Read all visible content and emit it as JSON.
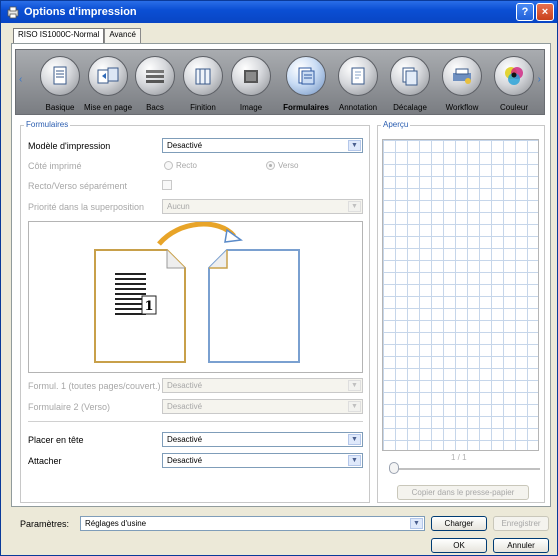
{
  "window": {
    "title": "Options d'impression",
    "help_glyph": "?",
    "close_glyph": "×"
  },
  "tabs": [
    {
      "label": "RISO IS1000C-Normal"
    },
    {
      "label": "Avancé"
    }
  ],
  "iconbar": {
    "left_arrow": "‹",
    "right_arrow": "›",
    "items": [
      {
        "label": "Basique",
        "icon": "document-icon"
      },
      {
        "label": "Mise en page",
        "icon": "layout-icon"
      },
      {
        "label": "Bacs",
        "icon": "paper-trays-icon"
      },
      {
        "label": "Finition",
        "icon": "finishing-icon"
      },
      {
        "label": "Image",
        "icon": "image-icon"
      },
      {
        "label": "Formulaires",
        "icon": "forms-icon"
      },
      {
        "label": "Annotation",
        "icon": "annotation-icon"
      },
      {
        "label": "Décalage",
        "icon": "offset-icon"
      },
      {
        "label": "Workflow",
        "icon": "workflow-icon"
      },
      {
        "label": "Couleur",
        "icon": "color-icon"
      }
    ],
    "active": "Formulaires"
  },
  "formulaires": {
    "section_title": "Formulaires",
    "modele_label": "Modèle d'impression",
    "modele_value": "Desactivé",
    "cote_label": "Côté imprimé",
    "recto_label": "Recto",
    "verso_label": "Verso",
    "recto_verso_label": "Recto/Verso séparément",
    "priorite_label": "Priorité dans la superposition",
    "priorite_value": "Aucun",
    "diagram_page_number": "1",
    "formul1_label": "Formul. 1 (toutes pages/couvert.)",
    "formul1_value": "Desactivé",
    "formul2_label": "Formulaire 2 (Verso)",
    "formul2_value": "Desactivé",
    "placer_label": "Placer en tête",
    "placer_value": "Desactivé",
    "attacher_label": "Attacher",
    "attacher_value": "Desactivé"
  },
  "apercu": {
    "section_title": "Aperçu",
    "page_indicator": "1 / 1",
    "copy_button": "Copier dans le presse-papier"
  },
  "bottom": {
    "parametres_label": "Paramètres:",
    "parametres_value": "Réglages d'usine",
    "charger_button": "Charger",
    "enregistrer_button": "Enregistrer",
    "ok_button": "OK",
    "annuler_button": "Annuler"
  },
  "colors": {
    "title_blue": "#0b4fd4",
    "accent": "#2a5db0",
    "diagram_gold": "#c8a04a",
    "diagram_blue": "#7aa0d0"
  }
}
